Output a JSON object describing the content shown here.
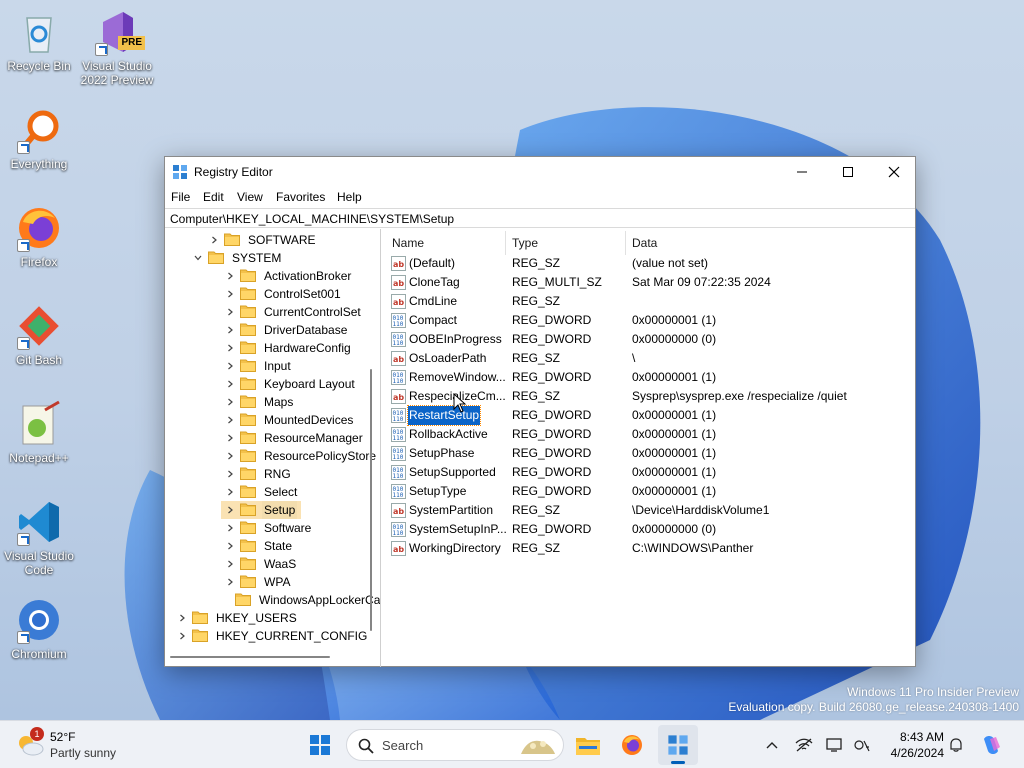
{
  "desktop": {
    "icons": [
      {
        "label": "Recycle Bin",
        "icon": "recycle-bin-icon"
      },
      {
        "label": "Visual Studio 2022 Preview",
        "icon": "visual-studio-preview-icon",
        "badge": "PRE"
      },
      {
        "label": "Everything",
        "icon": "everything-search-icon"
      },
      {
        "label": "Firefox",
        "icon": "firefox-icon"
      },
      {
        "label": "Git Bash",
        "icon": "git-bash-icon"
      },
      {
        "label": "Notepad++",
        "icon": "notepad-plus-plus-icon"
      },
      {
        "label": "Visual Studio Code",
        "icon": "vscode-icon"
      },
      {
        "label": "Chromium",
        "icon": "chromium-icon"
      }
    ],
    "watermark": {
      "line1": "Windows 11 Pro Insider Preview",
      "line2": "Evaluation copy. Build 26080.ge_release.240308-1400"
    }
  },
  "window": {
    "title": "Registry Editor",
    "controls": {
      "minimize": "minimize-icon",
      "maximize": "maximize-icon",
      "close": "close-icon"
    },
    "menu": [
      "File",
      "Edit",
      "View",
      "Favorites",
      "Help"
    ],
    "address": "Computer\\HKEY_LOCAL_MACHINE\\SYSTEM\\Setup",
    "tree": [
      {
        "label": "SOFTWARE",
        "expanded": false
      },
      {
        "label": "SYSTEM",
        "expanded": true
      },
      {
        "label": "ActivationBroker",
        "expanded": false
      },
      {
        "label": "ControlSet001",
        "expanded": false
      },
      {
        "label": "CurrentControlSet",
        "expanded": false
      },
      {
        "label": "DriverDatabase",
        "expanded": false
      },
      {
        "label": "HardwareConfig",
        "expanded": false
      },
      {
        "label": "Input",
        "expanded": false
      },
      {
        "label": "Keyboard Layout",
        "expanded": false
      },
      {
        "label": "Maps",
        "expanded": false
      },
      {
        "label": "MountedDevices",
        "expanded": false
      },
      {
        "label": "ResourceManager",
        "expanded": false
      },
      {
        "label": "ResourcePolicyStore",
        "expanded": false
      },
      {
        "label": "RNG",
        "expanded": false
      },
      {
        "label": "Select",
        "expanded": false
      },
      {
        "label": "Setup",
        "expanded": false,
        "selected": true
      },
      {
        "label": "Software",
        "expanded": false
      },
      {
        "label": "State",
        "expanded": false
      },
      {
        "label": "WaaS",
        "expanded": false
      },
      {
        "label": "WPA",
        "expanded": false
      },
      {
        "label": "WindowsAppLockerCac",
        "expanded": false
      },
      {
        "label": "HKEY_USERS",
        "expanded": false
      },
      {
        "label": "HKEY_CURRENT_CONFIG",
        "expanded": false
      }
    ],
    "columns": {
      "name": "Name",
      "type": "Type",
      "data": "Data"
    },
    "values": [
      {
        "name": "(Default)",
        "type": "REG_SZ",
        "data": "(value not set)",
        "kind": "string"
      },
      {
        "name": "CloneTag",
        "type": "REG_MULTI_SZ",
        "data": "Sat Mar 09 07:22:35 2024",
        "kind": "string"
      },
      {
        "name": "CmdLine",
        "type": "REG_SZ",
        "data": "",
        "kind": "string"
      },
      {
        "name": "Compact",
        "type": "REG_DWORD",
        "data": "0x00000001 (1)",
        "kind": "binary"
      },
      {
        "name": "OOBEInProgress",
        "type": "REG_DWORD",
        "data": "0x00000000 (0)",
        "kind": "binary"
      },
      {
        "name": "OsLoaderPath",
        "type": "REG_SZ",
        "data": "\\",
        "kind": "string"
      },
      {
        "name": "RemoveWindow...",
        "type": "REG_DWORD",
        "data": "0x00000001 (1)",
        "kind": "binary"
      },
      {
        "name": "RespecializeCm...",
        "type": "REG_SZ",
        "data": "Sysprep\\sysprep.exe /respecialize /quiet",
        "kind": "string"
      },
      {
        "name": "RestartSetup",
        "type": "REG_DWORD",
        "data": "0x00000001 (1)",
        "kind": "binary",
        "selected": true
      },
      {
        "name": "RollbackActive",
        "type": "REG_DWORD",
        "data": "0x00000001 (1)",
        "kind": "binary"
      },
      {
        "name": "SetupPhase",
        "type": "REG_DWORD",
        "data": "0x00000001 (1)",
        "kind": "binary"
      },
      {
        "name": "SetupSupported",
        "type": "REG_DWORD",
        "data": "0x00000001 (1)",
        "kind": "binary"
      },
      {
        "name": "SetupType",
        "type": "REG_DWORD",
        "data": "0x00000001 (1)",
        "kind": "binary"
      },
      {
        "name": "SystemPartition",
        "type": "REG_SZ",
        "data": "\\Device\\HarddiskVolume1",
        "kind": "string"
      },
      {
        "name": "SystemSetupInP...",
        "type": "REG_DWORD",
        "data": "0x00000000 (0)",
        "kind": "binary"
      },
      {
        "name": "WorkingDirectory",
        "type": "REG_SZ",
        "data": "C:\\WINDOWS\\Panther",
        "kind": "string"
      }
    ]
  },
  "taskbar": {
    "weather": {
      "temp": "52°F",
      "condition": "Partly sunny",
      "badge": "1"
    },
    "search_label": "Search",
    "apps": [
      "start-icon",
      "file-explorer-icon",
      "firefox-icon",
      "registry-editor-icon"
    ],
    "tray": [
      "chevron-up-icon",
      "network-icon",
      "display-icon",
      "language-icon"
    ],
    "time": "8:43 AM",
    "date": "4/26/2024",
    "colors": {
      "accent": "#005fb8",
      "selection": "#0a64c8"
    }
  }
}
